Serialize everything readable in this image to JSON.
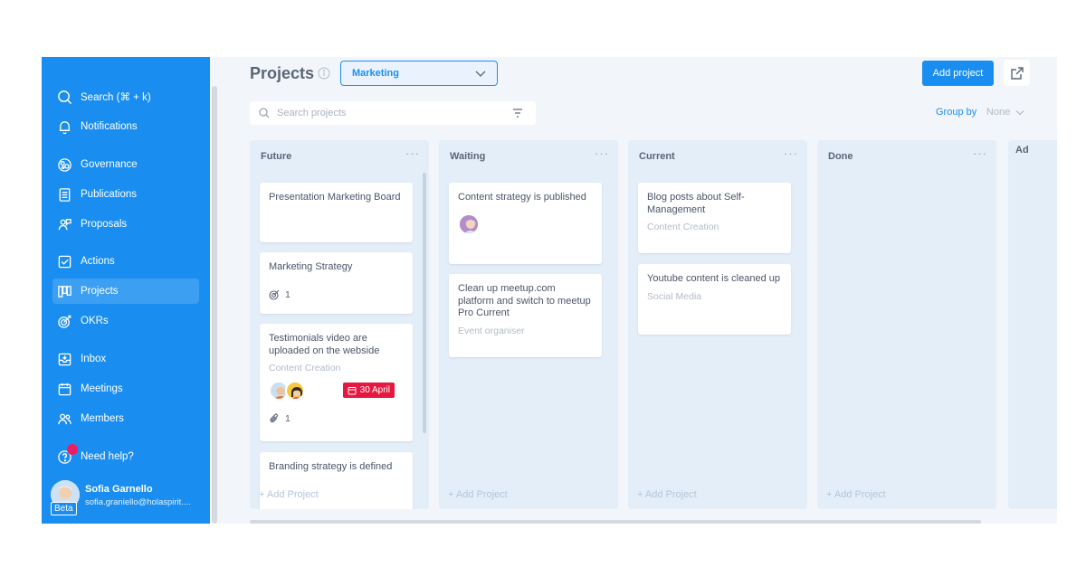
{
  "sidebar": {
    "items": [
      {
        "label": "Search  (⌘ + k)",
        "icon": "search-icon"
      },
      {
        "label": "Notifications",
        "icon": "bell-icon"
      },
      {
        "label": "Governance",
        "icon": "governance-icon"
      },
      {
        "label": "Publications",
        "icon": "document-icon"
      },
      {
        "label": "Proposals",
        "icon": "proposals-icon"
      },
      {
        "label": "Actions",
        "icon": "checkbox-icon"
      },
      {
        "label": "Projects",
        "icon": "kanban-icon",
        "active": true
      },
      {
        "label": "OKRs",
        "icon": "target-icon"
      },
      {
        "label": "Inbox",
        "icon": "inbox-icon"
      },
      {
        "label": "Meetings",
        "icon": "calendar-icon"
      },
      {
        "label": "Members",
        "icon": "members-icon"
      },
      {
        "label": "Need help?",
        "icon": "help-icon"
      }
    ],
    "user": {
      "name": "Sofia Garnello",
      "email": "sofia.graniello@holaspirit....",
      "badge": "Beta"
    }
  },
  "header": {
    "title": "Projects",
    "circle_selector": "Marketing",
    "add_button": "Add project",
    "search_placeholder": "Search projects",
    "group_by_label": "Group by",
    "group_by_value": "None"
  },
  "columns": [
    {
      "title": "Future",
      "cards": [
        {
          "title": "Presentation Marketing Board"
        },
        {
          "title": "Marketing Strategy",
          "okr_count": "1"
        },
        {
          "title": "Testimonials video are uploaded on the webside",
          "subtitle": "Content Creation",
          "due": "30 April",
          "attachments": "1"
        },
        {
          "title": "Branding strategy is defined"
        }
      ],
      "add_label": "+ Add Project"
    },
    {
      "title": "Waiting",
      "cards": [
        {
          "title": "Content strategy is published"
        },
        {
          "title": "Clean up meetup.com platform and switch to meetup Pro Current",
          "subtitle": "Event organiser"
        }
      ],
      "add_label": "+ Add Project"
    },
    {
      "title": "Current",
      "cards": [
        {
          "title": "Blog posts about Self-Management",
          "subtitle": "Content Creation"
        },
        {
          "title": "Youtube content is cleaned up",
          "subtitle": "Social Media"
        }
      ],
      "add_label": "+ Add Project"
    },
    {
      "title": "Done",
      "cards": [],
      "add_label": "+ Add Project"
    }
  ],
  "partial_column_title": "Ad",
  "colors": {
    "sidebar": "#1a8ef0",
    "accent": "#1a8ef0",
    "due_badge": "#e8173f",
    "column_bg": "#e3eef9"
  }
}
